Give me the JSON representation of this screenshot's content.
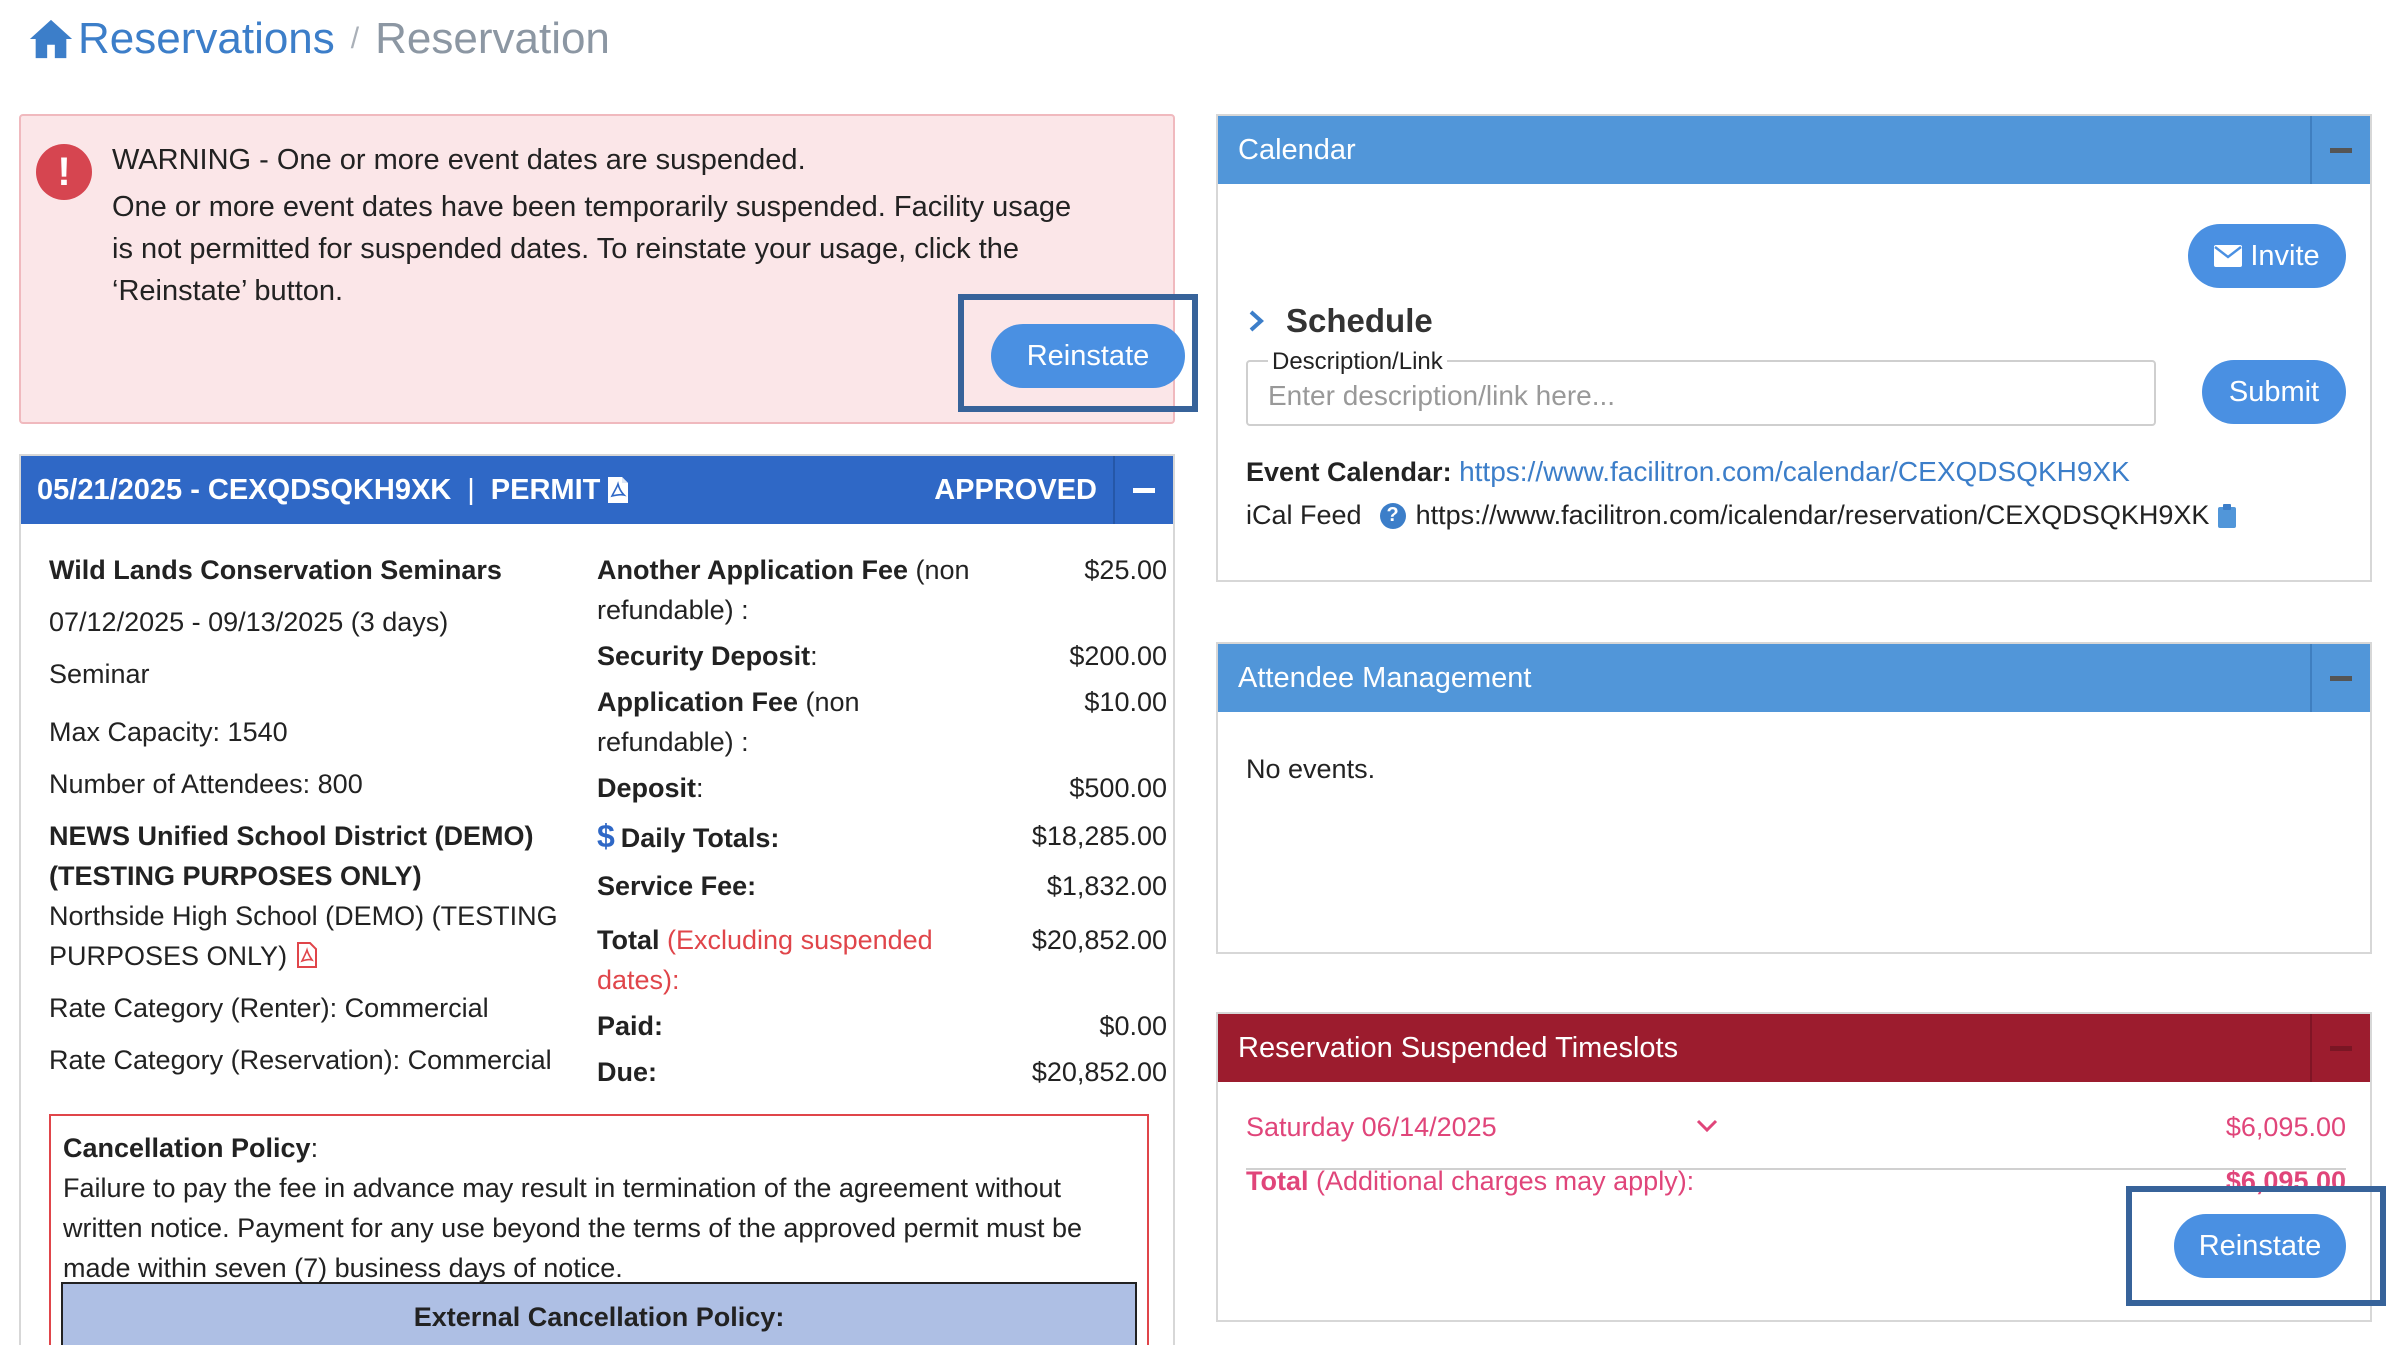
{
  "breadcrumb": {
    "root": "Reservations",
    "separator": "/",
    "current": "Reservation"
  },
  "warning": {
    "title": "WARNING - One or more event dates are suspended.",
    "body": "One or more event dates have been temporarily suspended. Facility usage is not permitted for suspended dates. To reinstate your usage, click the ‘Reinstate’ button.",
    "button": "Reinstate"
  },
  "reservation": {
    "date_code": "05/21/2025 - CEXQDSQKH9XK",
    "separator": "|",
    "permit_label": "PERMIT",
    "status": "APPROVED",
    "title": "Wild Lands Conservation Seminars",
    "date_range": "07/12/2025 - 09/13/2025 (3 days)",
    "type": "Seminar",
    "max_capacity": "Max Capacity: 1540",
    "attendees": "Number of Attendees: 800",
    "district": "NEWS Unified School District (DEMO) (TESTING PURPOSES ONLY)",
    "school": "Northside High School (DEMO) (TESTING PURPOSES ONLY)",
    "rate_renter": "Rate Category (Renter): Commercial",
    "rate_reservation": "Rate Category (Reservation): Commercial",
    "fees": {
      "another_app_fee_bold": "Another Application Fee",
      "another_app_fee_rest": " (non refundable) :",
      "another_app_fee_amt": "$25.00",
      "security_deposit_label": "Security Deposit",
      "security_deposit_colon": ":",
      "security_deposit_amt": "$200.00",
      "app_fee_bold": "Application Fee",
      "app_fee_rest": " (non refundable) :",
      "app_fee_amt": "$10.00",
      "deposit_label": "Deposit",
      "deposit_colon": ":",
      "deposit_amt": "$500.00",
      "daily_totals_label": "Daily Totals:",
      "daily_totals_amt": "$18,285.00",
      "service_fee_label": "Service Fee:",
      "service_fee_amt": "$1,832.00",
      "total_label": "Total",
      "total_note": " (Excluding suspended dates):",
      "total_amt": "$20,852.00",
      "paid_label": "Paid:",
      "paid_amt": "$0.00",
      "due_label": "Due:",
      "due_amt": "$20,852.00"
    },
    "cancellation": {
      "label": "Cancellation Policy",
      "colon": ":",
      "text": "Failure to pay the fee in advance may result in termination of the agreement without written notice. Payment for any use beyond the terms of the approved permit must be made within seven (7) business days of notice.",
      "external_label": "External Cancellation Policy:"
    }
  },
  "calendar": {
    "title": "Calendar",
    "invite": "Invite",
    "schedule": "Schedule",
    "desc_label": "Description/Link",
    "desc_placeholder": "Enter description/link here...",
    "submit": "Submit",
    "event_cal_label": "Event Calendar:",
    "event_cal_link": "https://www.facilitron.com/calendar/CEXQDSQKH9XK",
    "ical_label": "iCal Feed",
    "ical_url": "https://www.facilitron.com/icalendar/reservation/CEXQDSQKH9XK"
  },
  "attendee": {
    "title": "Attendee Management",
    "empty": "No events."
  },
  "suspended": {
    "title": "Reservation Suspended Timeslots",
    "date": "Saturday 06/14/2025",
    "date_amt": "$6,095.00",
    "total_label": "Total",
    "total_note": " (Additional charges may apply):",
    "total_amt": "$6,095.00",
    "button": "Reinstate"
  },
  "colors": {
    "primary_blue": "#2f68c6",
    "panel_blue": "#5196d9",
    "button_blue": "#4a90e2",
    "danger_red": "#9c1c2e",
    "warning_bg": "#fbe6e8",
    "highlight": "#37639a"
  }
}
